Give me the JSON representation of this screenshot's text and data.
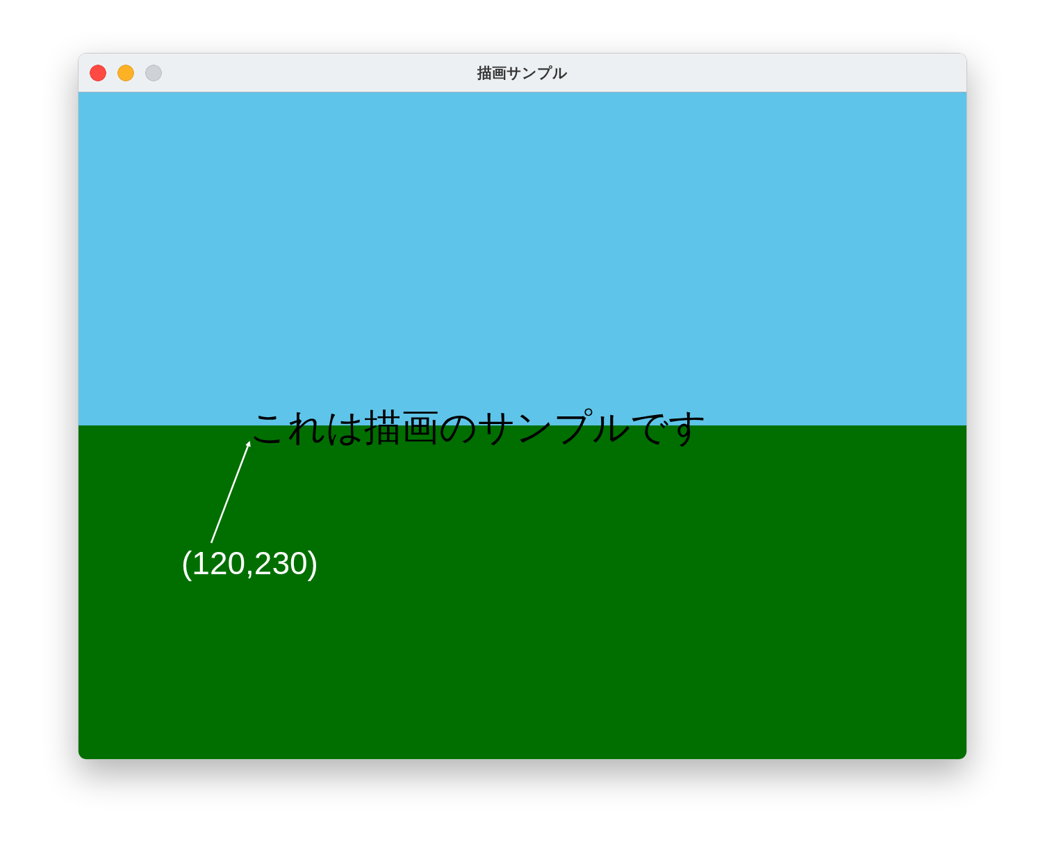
{
  "window": {
    "title": "描画サンプル"
  },
  "canvas": {
    "caption": "これは描画のサンプルです",
    "point_label": "(120,230)"
  }
}
